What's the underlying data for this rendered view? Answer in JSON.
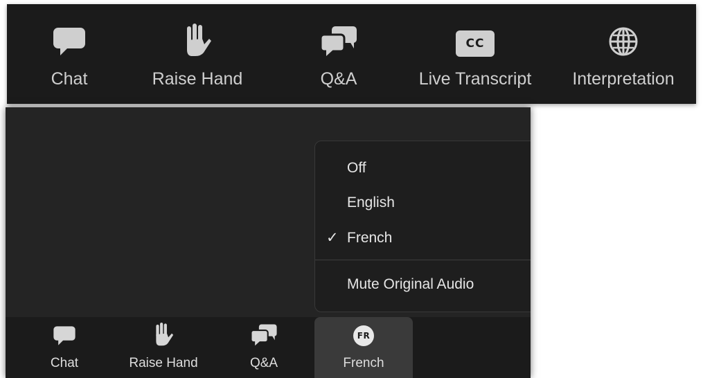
{
  "top_toolbar": {
    "chat_label": "Chat",
    "raise_hand_label": "Raise Hand",
    "qa_label": "Q&A",
    "live_transcript_label": "Live Transcript",
    "cc_icon_text": "CC",
    "interpretation_label": "Interpretation"
  },
  "language_menu": {
    "items": [
      "Off",
      "English",
      "French"
    ],
    "selected": "French",
    "check_mark": "✓",
    "mute_original_label": "Mute Original Audio"
  },
  "bottom_toolbar": {
    "chat_label": "Chat",
    "raise_hand_label": "Raise Hand",
    "qa_label": "Q&A",
    "french_badge": "FR",
    "french_label": "French"
  },
  "colors": {
    "toolbar_bg": "#1b1b1b",
    "window_bg": "#242424",
    "icon": "#cfcfcf",
    "active_button_bg": "#3a3a3a"
  }
}
